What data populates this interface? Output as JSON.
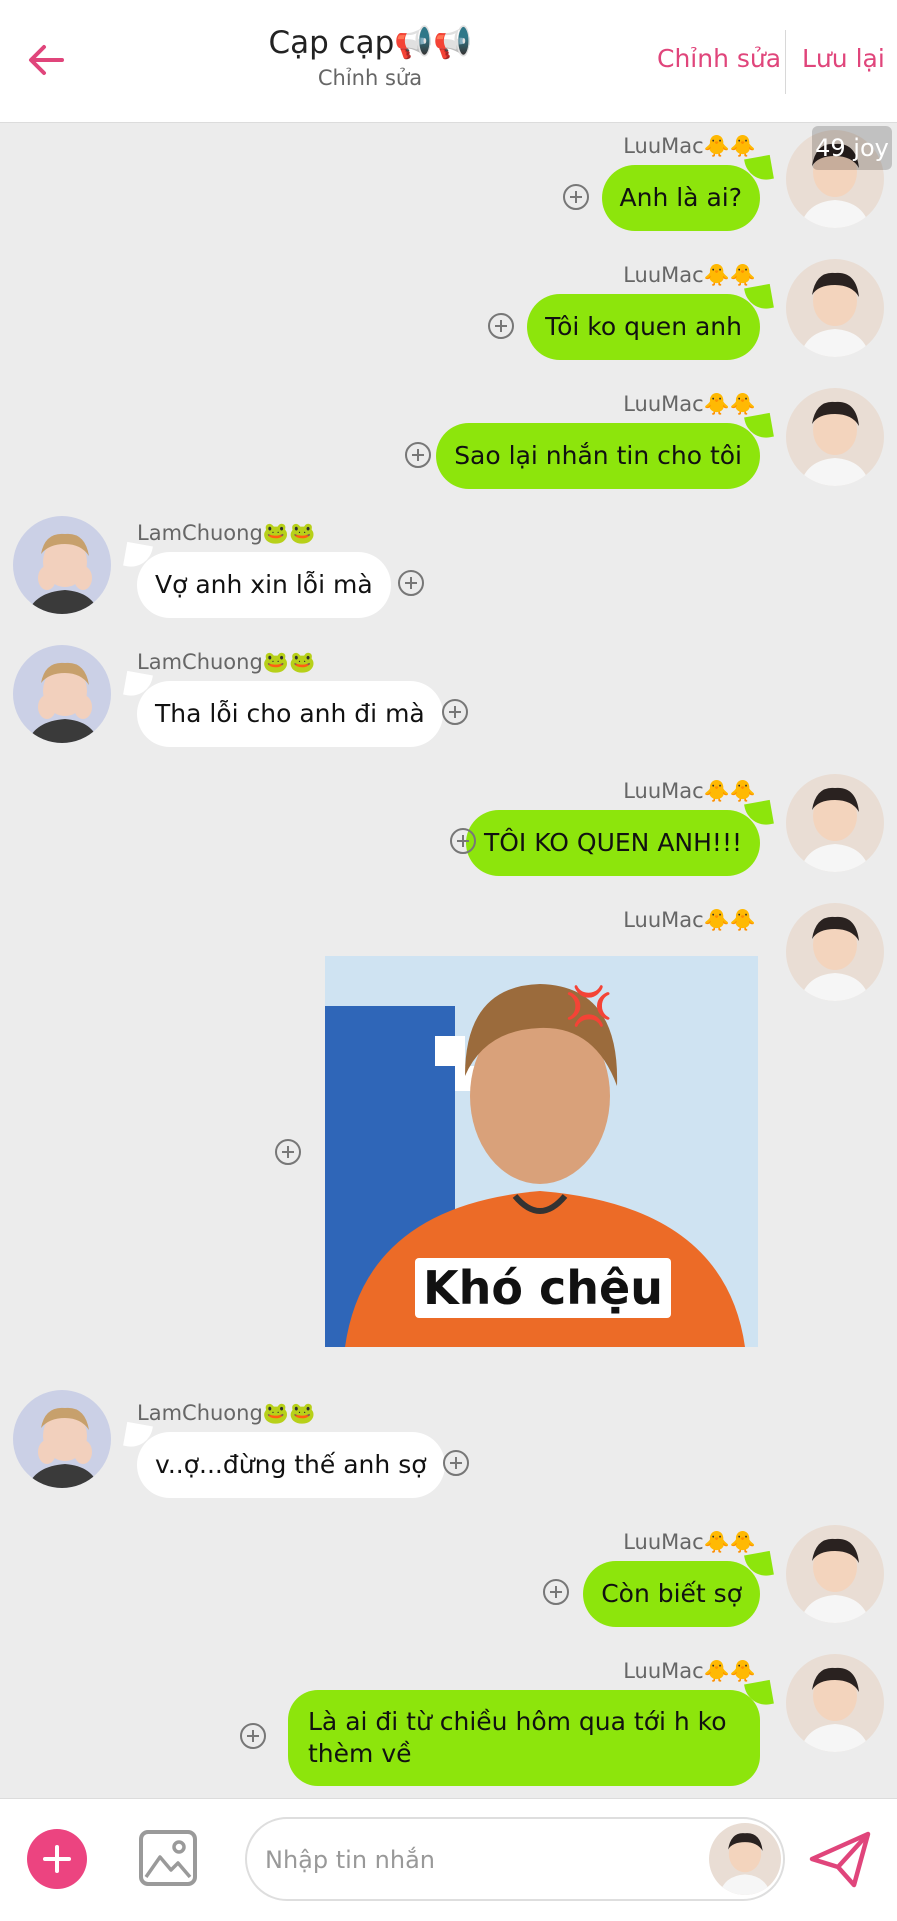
{
  "header": {
    "title": "Cạp cạp📢📢",
    "subtitle": "Chỉnh sửa",
    "edit_label": "Chỉnh sửa",
    "save_label": "Lưu lại",
    "back_icon": "arrow-left-icon",
    "accent_color": "#e0457b"
  },
  "watermark": "49 joy",
  "sticker": {
    "caption": "Khó chệu",
    "anger_mark": "💢"
  },
  "messages": [
    {
      "side": "out",
      "sender": "LuuMac🐥🐥",
      "text": "Anh là ai?"
    },
    {
      "side": "out",
      "sender": "LuuMac🐥🐥",
      "text": "Tôi ko quen anh"
    },
    {
      "side": "out",
      "sender": "LuuMac🐥🐥",
      "text": "Sao lại nhắn tin cho tôi"
    },
    {
      "side": "in",
      "sender": "LamChuong🐸🐸",
      "text": "Vợ anh xin lỗi mà"
    },
    {
      "side": "in",
      "sender": "LamChuong🐸🐸",
      "text": "Tha lỗi cho anh đi mà"
    },
    {
      "side": "out",
      "sender": "LuuMac🐥🐥",
      "text": "TÔI KO QUEN ANH!!!"
    },
    {
      "side": "out",
      "sender": "LuuMac🐥🐥",
      "text": ""
    },
    {
      "side": "in",
      "sender": "LamChuong🐸🐸",
      "text": "v..ợ...đừng thế anh sợ"
    },
    {
      "side": "out",
      "sender": "LuuMac🐥🐥",
      "text": "Còn biết sợ"
    },
    {
      "side": "out",
      "sender": "LuuMac🐥🐥",
      "text": "Là ai đi từ chiều hôm qua tới h ko thèm về"
    }
  ],
  "footer": {
    "placeholder": "Nhập tin nhắn",
    "add_icon": "plus-circle-icon",
    "image_icon": "image-icon",
    "send_icon": "send-icon"
  },
  "colors": {
    "outgoing_bubble": "#8de50c",
    "incoming_bubble": "#ffffff",
    "background": "#ececec",
    "fab": "#ec4480"
  }
}
